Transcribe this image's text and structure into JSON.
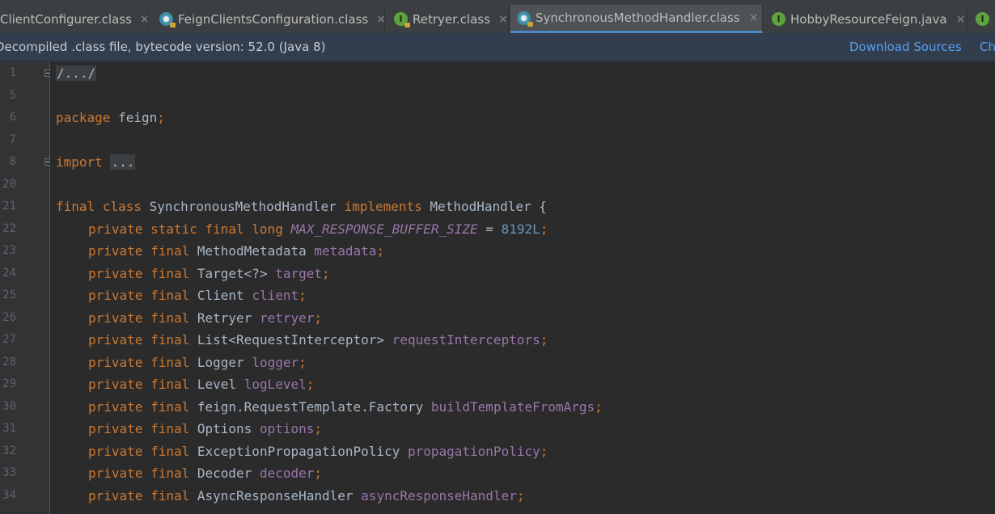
{
  "tabs": [
    {
      "label": "ClientConfigurer.class",
      "icon": "class-icon",
      "active": false
    },
    {
      "label": "FeignClientsConfiguration.class",
      "icon": "class-icon",
      "active": false
    },
    {
      "label": "Retryer.class",
      "icon": "interface-icon",
      "active": false
    },
    {
      "label": "SynchronousMethodHandler.class",
      "icon": "class-icon",
      "active": true
    },
    {
      "label": "HobbyResourceFeign.java",
      "icon": "interface-icon",
      "active": false
    }
  ],
  "close_glyph": "×",
  "infobar": {
    "message": "Decompiled .class file, bytecode version: 52.0 (Java 8)",
    "download_sources": "Download Sources",
    "choose_sources": "Ch"
  },
  "gutter": {
    "line_numbers": [
      "1",
      "5",
      "6",
      "7",
      "8",
      "20",
      "21",
      "22",
      "23",
      "24",
      "25",
      "26",
      "27",
      "28",
      "29",
      "30",
      "31",
      "32",
      "33",
      "34"
    ]
  },
  "code": {
    "fold_header": "/.../",
    "package_kw": "package",
    "package_name": " feign",
    "semicolon": ";",
    "import_kw": "import",
    "import_fold": "...",
    "class_decl": {
      "final_kw": "final",
      "class_kw": "class",
      "name": "SynchronousMethodHandler",
      "implements_kw": "implements",
      "iface": "MethodHandler",
      "brace": "{"
    },
    "const_decl": {
      "modifiers": "private static final long",
      "name": "MAX_RESPONSE_BUFFER_SIZE",
      "eq": " = ",
      "value": "8192L"
    },
    "fields": [
      {
        "modifiers": "private final",
        "type": "MethodMetadata",
        "name": "metadata"
      },
      {
        "modifiers": "private final",
        "type": "Target<?>",
        "name": "target"
      },
      {
        "modifiers": "private final",
        "type": "Client",
        "name": "client"
      },
      {
        "modifiers": "private final",
        "type": "Retryer",
        "name": "retryer"
      },
      {
        "modifiers": "private final",
        "type": "List<RequestInterceptor>",
        "name": "requestInterceptors"
      },
      {
        "modifiers": "private final",
        "type": "Logger",
        "name": "logger"
      },
      {
        "modifiers": "private final",
        "type": "Level",
        "name": "logLevel"
      },
      {
        "modifiers": "private final",
        "type": "feign.RequestTemplate.Factory",
        "name": "buildTemplateFromArgs"
      },
      {
        "modifiers": "private final",
        "type": "Options",
        "name": "options"
      },
      {
        "modifiers": "private final",
        "type": "ExceptionPropagationPolicy",
        "name": "propagationPolicy"
      },
      {
        "modifiers": "private final",
        "type": "Decoder",
        "name": "decoder"
      },
      {
        "modifiers": "private final",
        "type": "AsyncResponseHandler",
        "name": "asyncResponseHandler"
      }
    ]
  },
  "colors": {
    "keyword": "#cc7832",
    "field": "#9876aa",
    "number": "#6897bb",
    "text": "#a9b7c6",
    "link": "#589df6",
    "active_tab_underline": "#4a88c7"
  }
}
